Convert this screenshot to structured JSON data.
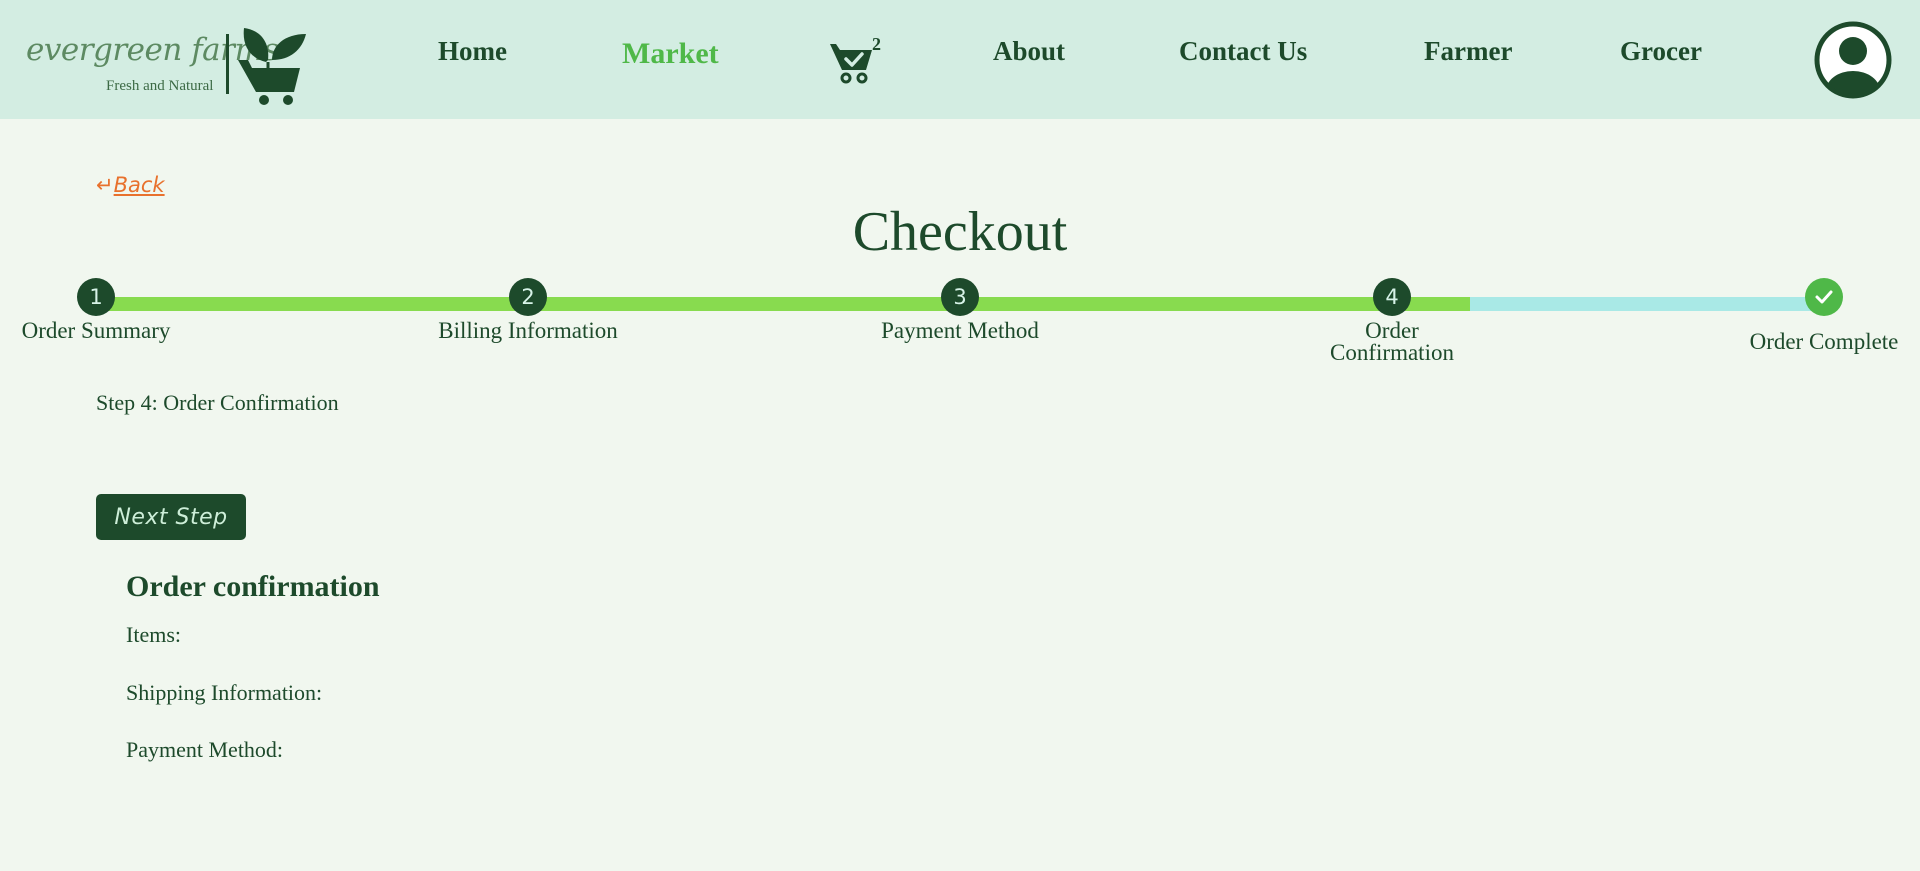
{
  "header": {
    "logo": {
      "name": "evergreen farms",
      "tagline": "Fresh and Natural"
    },
    "nav": [
      {
        "label": "Home",
        "active": false
      },
      {
        "label": "Market",
        "active": true
      },
      {
        "label": "About",
        "active": false
      },
      {
        "label": "Contact Us",
        "active": false
      },
      {
        "label": "Farmer",
        "active": false
      },
      {
        "label": "Grocer",
        "active": false
      }
    ],
    "cart_count": "2",
    "icons": {
      "cart": "cart-check-icon",
      "avatar": "user-avatar-icon"
    }
  },
  "back": {
    "arrow": "↵",
    "label": "Back"
  },
  "title": "Checkout",
  "progress": {
    "current_step": 4,
    "steps": [
      {
        "number": "1",
        "label": "Order Summary"
      },
      {
        "number": "2",
        "label": "Billing Information"
      },
      {
        "number": "3",
        "label": "Payment Method"
      },
      {
        "number": "4",
        "label": "Order Confirmation"
      },
      {
        "number": "",
        "label": "Order Complete",
        "icon": "check-icon"
      }
    ]
  },
  "step_text": "Step 4: Order Confirmation",
  "next_button": "Next Step",
  "confirmation": {
    "title": "Order confirmation",
    "items_label": "Items:",
    "shipping_label": "Shipping Information:",
    "payment_label": "Payment Method:"
  },
  "colors": {
    "header_bg": "#d3ede2",
    "page_bg": "#f1f7ef",
    "primary": "#1d4a2b",
    "active_nav": "#4fb848",
    "back_link": "#e8712d",
    "progress_done": "#88db4f",
    "progress_todo": "#a9e9e6"
  }
}
